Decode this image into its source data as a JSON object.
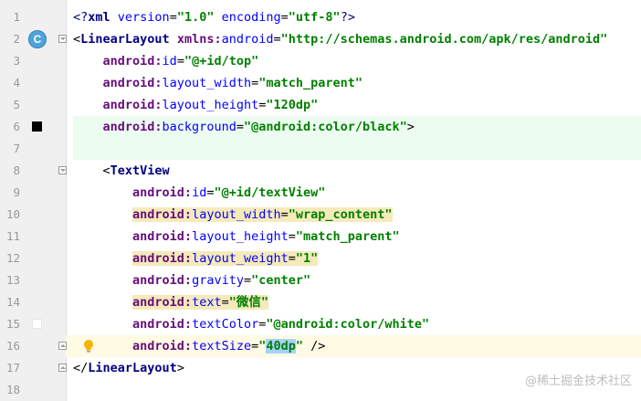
{
  "editor": {
    "lines": [
      {
        "n": "1",
        "segs": [
          [
            "pi",
            "<?"
          ],
          [
            "tag",
            "xml "
          ],
          [
            "attr",
            "version"
          ],
          [
            "punc",
            "="
          ],
          [
            "str",
            "\"1.0\" "
          ],
          [
            "attr",
            "encoding"
          ],
          [
            "punc",
            "="
          ],
          [
            "str",
            "\"utf-8\""
          ],
          [
            "pi",
            "?>"
          ]
        ]
      },
      {
        "n": "2",
        "segs": [
          [
            "punc",
            "<"
          ],
          [
            "tag",
            "LinearLayout "
          ],
          [
            "ns",
            "xmlns:"
          ],
          [
            "attr",
            "android"
          ],
          [
            "punc",
            "="
          ],
          [
            "str",
            "\"http://schemas.android.com/apk/res/android\""
          ]
        ]
      },
      {
        "n": "3",
        "segs": [
          [
            "punc",
            "    "
          ],
          [
            "ns",
            "android:"
          ],
          [
            "attr",
            "id"
          ],
          [
            "punc",
            "="
          ],
          [
            "str",
            "\"@+id/top\""
          ]
        ]
      },
      {
        "n": "4",
        "segs": [
          [
            "punc",
            "    "
          ],
          [
            "ns",
            "android:"
          ],
          [
            "attr",
            "layout_width"
          ],
          [
            "punc",
            "="
          ],
          [
            "str",
            "\"match_parent\""
          ]
        ]
      },
      {
        "n": "5",
        "segs": [
          [
            "punc",
            "    "
          ],
          [
            "ns",
            "android:"
          ],
          [
            "attr",
            "layout_height"
          ],
          [
            "punc",
            "="
          ],
          [
            "str",
            "\"120dp\""
          ]
        ]
      },
      {
        "n": "6",
        "segs": [
          [
            "punc",
            "    "
          ],
          [
            "ns",
            "android:"
          ],
          [
            "attr",
            "background"
          ],
          [
            "punc",
            "="
          ],
          [
            "str",
            "\"@android:color/black\""
          ],
          [
            "punc",
            ">"
          ]
        ]
      },
      {
        "n": "7",
        "segs": []
      },
      {
        "n": "8",
        "segs": [
          [
            "punc",
            "    <"
          ],
          [
            "tag",
            "TextView"
          ]
        ]
      },
      {
        "n": "9",
        "segs": [
          [
            "punc",
            "        "
          ],
          [
            "ns",
            "android:"
          ],
          [
            "attr",
            "id"
          ],
          [
            "punc",
            "="
          ],
          [
            "str",
            "\"@+id/textView\""
          ]
        ]
      },
      {
        "n": "10",
        "segs": [
          [
            "punc",
            "        "
          ],
          [
            "ns",
            "android:"
          ],
          [
            "attr",
            "layout_width"
          ],
          [
            "punc",
            "="
          ],
          [
            "str",
            "\"wrap_content\""
          ]
        ]
      },
      {
        "n": "11",
        "segs": [
          [
            "punc",
            "        "
          ],
          [
            "ns",
            "android:"
          ],
          [
            "attr",
            "layout_height"
          ],
          [
            "punc",
            "="
          ],
          [
            "str",
            "\"match_parent\""
          ]
        ]
      },
      {
        "n": "12",
        "segs": [
          [
            "punc",
            "        "
          ],
          [
            "ns",
            "android:"
          ],
          [
            "attr",
            "layout_weight"
          ],
          [
            "punc",
            "="
          ],
          [
            "str",
            "\"1\""
          ]
        ]
      },
      {
        "n": "13",
        "segs": [
          [
            "punc",
            "        "
          ],
          [
            "ns",
            "android:"
          ],
          [
            "attr",
            "gravity"
          ],
          [
            "punc",
            "="
          ],
          [
            "str",
            "\"center\""
          ]
        ]
      },
      {
        "n": "14",
        "segs": [
          [
            "punc",
            "        "
          ],
          [
            "ns",
            "android:"
          ],
          [
            "attr",
            "text"
          ],
          [
            "punc",
            "="
          ],
          [
            "str",
            "\"微信\""
          ]
        ]
      },
      {
        "n": "15",
        "segs": [
          [
            "punc",
            "        "
          ],
          [
            "ns",
            "android:"
          ],
          [
            "attr",
            "textColor"
          ],
          [
            "punc",
            "="
          ],
          [
            "str",
            "\"@android:color/white\""
          ]
        ]
      },
      {
        "n": "16",
        "segs": [
          [
            "punc",
            "        "
          ],
          [
            "ns",
            "android:"
          ],
          [
            "attr",
            "textSize"
          ],
          [
            "punc",
            "="
          ],
          [
            "str",
            "\""
          ],
          [
            "sel",
            "40dp"
          ],
          [
            "str",
            "\""
          ],
          [
            "punc",
            " />"
          ]
        ]
      },
      {
        "n": "17",
        "segs": [
          [
            "punc",
            "</"
          ],
          [
            "tag",
            "LinearLayout"
          ],
          [
            "punc",
            ">"
          ]
        ]
      },
      {
        "n": "18",
        "segs": []
      }
    ],
    "colors": {
      "tag": "#000080",
      "namespace": "#660e7a",
      "attribute": "#0000ff",
      "string": "#008000",
      "line_highlight_green": "#edfcf0",
      "line_highlight_yellow": "#fffae3",
      "attr_highlight": "#f5eaba",
      "swatch_black": "#000000",
      "swatch_white": "#ffffff",
      "class_icon": "#4fa3d8"
    },
    "gutter_icons": {
      "line2": "class-icon",
      "line6": "color-swatch-black",
      "line15": "color-swatch-white",
      "line16": "lightbulb-icon"
    },
    "class_icon_label": "C"
  },
  "watermark": "@稀土掘金技术社区"
}
